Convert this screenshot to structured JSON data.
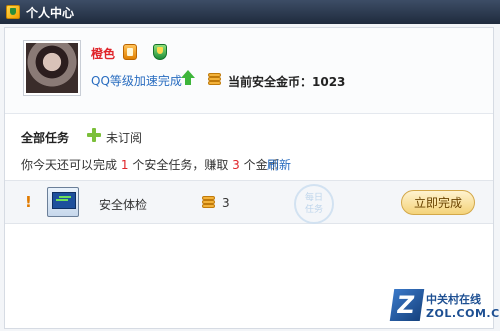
{
  "window": {
    "title": "个人中心",
    "icon": "shield-app-icon"
  },
  "profile": {
    "nickname": "橙色",
    "badges": [
      "vip-badge-icon",
      "security-shield-icon"
    ],
    "speedup_text": "QQ等级加速完成",
    "speedup_icon": "arrow-up-icon",
    "coins_label": "当前安全金币：1023",
    "coins_icon": "coin-stack-icon"
  },
  "tasks": {
    "heading": "全部任务",
    "subscribe_label": "未订阅",
    "subscribe_icon": "plus-icon",
    "desc_prefix": "你今天还可以完成",
    "desc_tasks": "1",
    "desc_middle": "个安全任务，赚取",
    "desc_coins": "3",
    "desc_suffix": "个金币",
    "refresh_label": "刷新",
    "items": [
      {
        "alert_mark": "!",
        "icon": "system-check-monitor-icon",
        "name": "安全体检",
        "reward": "3",
        "reward_icon": "coin-stack-icon",
        "stamp_line1": "每日",
        "stamp_line2": "任务",
        "action_label": "立即完成"
      }
    ]
  },
  "watermark": {
    "name": "中关村在线",
    "url": "ZOL.COM.CN"
  }
}
